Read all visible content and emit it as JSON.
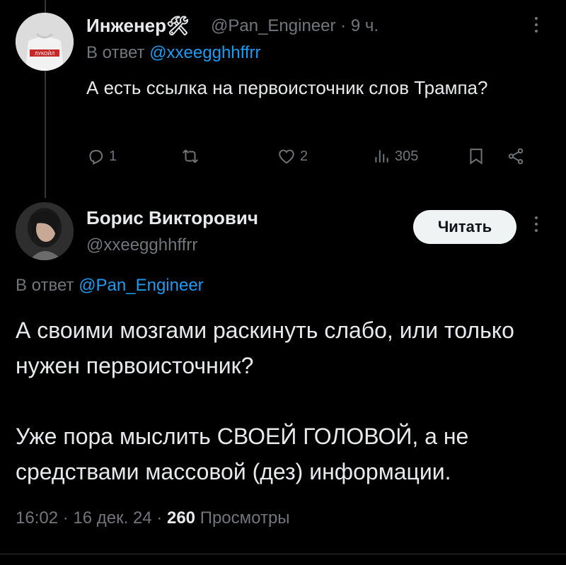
{
  "tweet1": {
    "name": "Инженер",
    "badge": "🛠",
    "handle": "@Pan_Engineer",
    "time": "9 ч.",
    "reply_prefix": "В ответ",
    "reply_to": "@xxeegghhffrr",
    "text": "А есть ссылка на первоисточник слов Трампа?",
    "avatar_label": "ЛУКОЙЛ",
    "actions": {
      "replies": "1",
      "reposts": "",
      "likes": "2",
      "views": "305"
    }
  },
  "tweet2": {
    "name": "Борис Викторович",
    "handle": "@xxeegghhffrr",
    "follow_label": "Читать",
    "reply_prefix": "В ответ",
    "reply_to": "@Pan_Engineer",
    "paragraph1": "А своими мозгами раскинуть слабо, или только нужен первоисточник?",
    "paragraph2": "Уже пора мыслить СВОЕЙ ГОЛОВОЙ, а не средствами  массовой (дез) информации.",
    "time": "16:02",
    "date": "16 дек. 24",
    "views_count": "260",
    "views_label": "Просмотры"
  },
  "icons": [
    "reply-icon",
    "repost-icon",
    "like-icon",
    "views-icon",
    "bookmark-icon",
    "share-icon",
    "more-icon"
  ]
}
